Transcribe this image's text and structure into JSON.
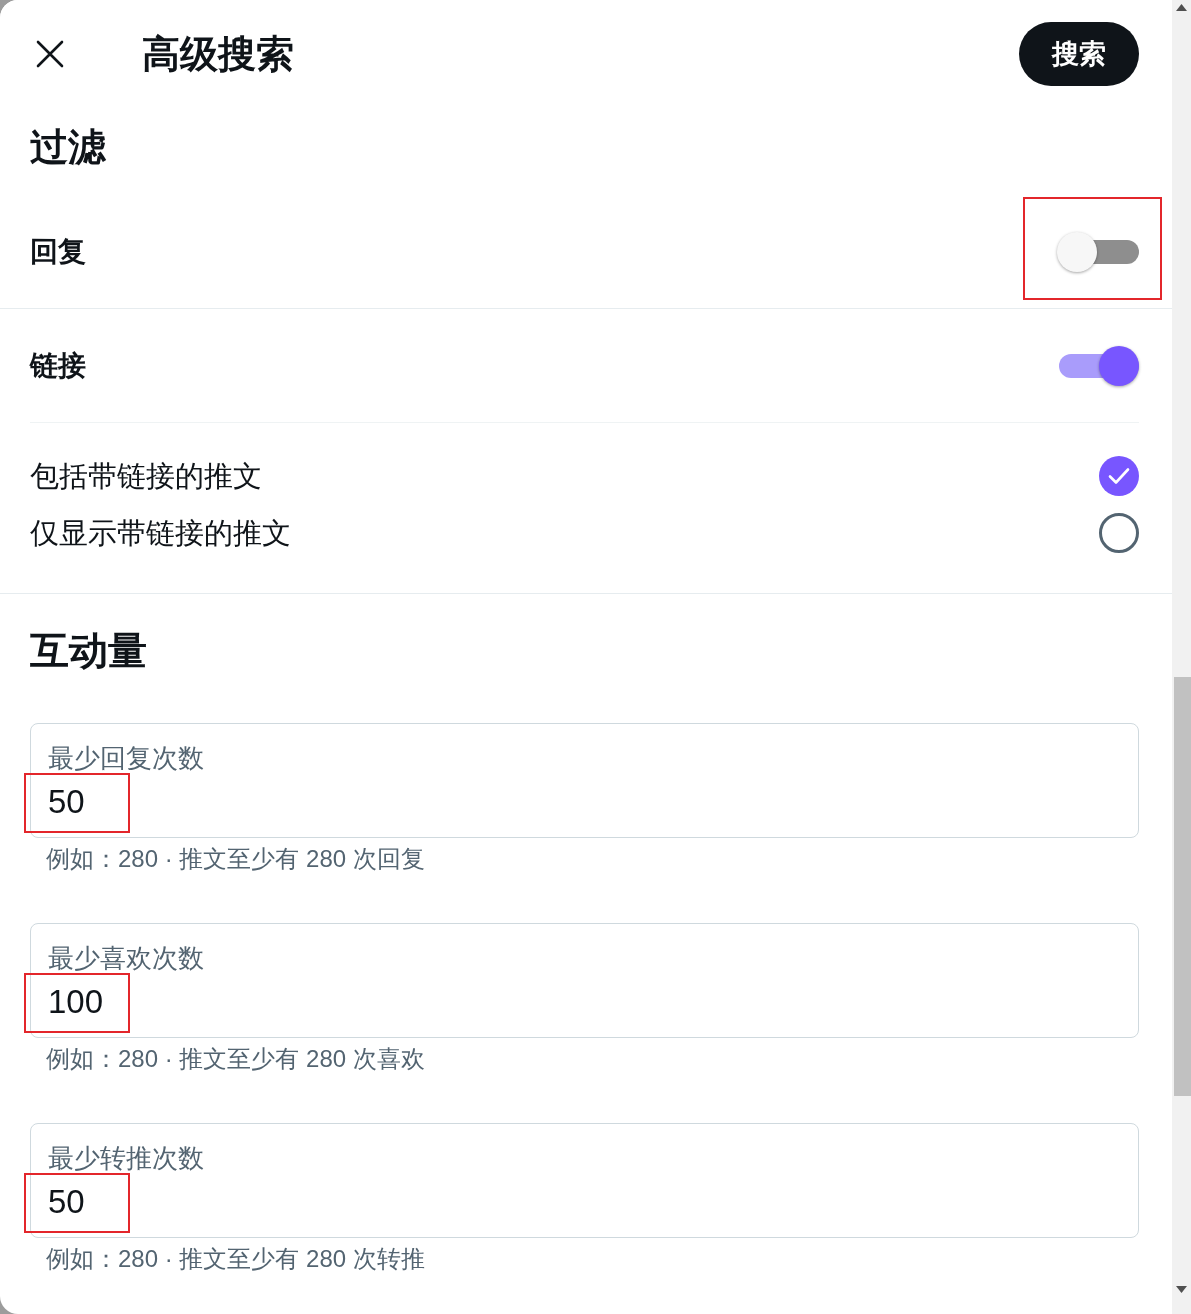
{
  "header": {
    "title": "高级搜索",
    "search_button": "搜索"
  },
  "filters": {
    "heading": "过滤",
    "toggles": [
      {
        "label": "回复",
        "on": false,
        "highlighted": true
      },
      {
        "label": "链接",
        "on": true,
        "options": [
          {
            "label": "包括带链接的推文",
            "selected": true
          },
          {
            "label": "仅显示带链接的推文",
            "selected": false
          }
        ]
      }
    ]
  },
  "engagement": {
    "heading": "互动量",
    "fields": [
      {
        "label": "最少回复次数",
        "value": "50",
        "hint": "例如：280 · 推文至少有 280 次回复",
        "highlighted": true
      },
      {
        "label": "最少喜欢次数",
        "value": "100",
        "hint": "例如：280 · 推文至少有 280 次喜欢",
        "highlighted": true
      },
      {
        "label": "最少转推次数",
        "value": "50",
        "hint": "例如：280 · 推文至少有 280 次转推",
        "highlighted": true
      }
    ]
  }
}
